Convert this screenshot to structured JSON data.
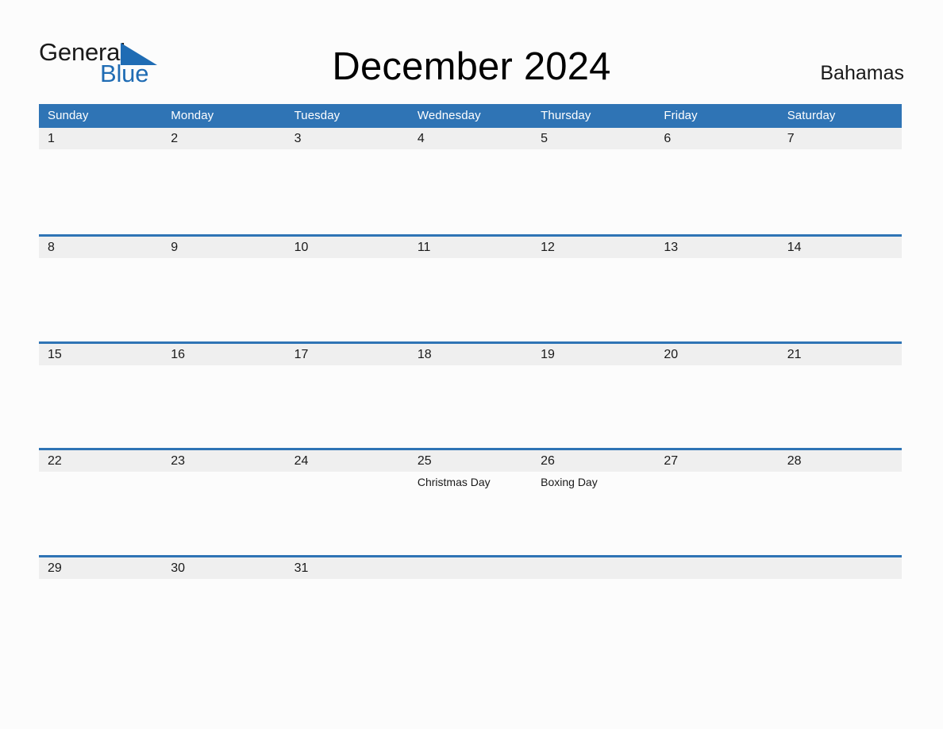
{
  "brand": {
    "name_part1": "General",
    "name_part2": "Blue",
    "accent_color": "#1f6cb4",
    "triangle_icon": "triangle-icon"
  },
  "header": {
    "title": "December 2024",
    "country": "Bahamas"
  },
  "calendar": {
    "month": "December",
    "year": "2024",
    "header_bg": "#2f74b5",
    "daynum_band_bg": "#efefef",
    "weekdays": [
      "Sunday",
      "Monday",
      "Tuesday",
      "Wednesday",
      "Thursday",
      "Friday",
      "Saturday"
    ],
    "weeks": [
      [
        {
          "day": "1",
          "event": ""
        },
        {
          "day": "2",
          "event": ""
        },
        {
          "day": "3",
          "event": ""
        },
        {
          "day": "4",
          "event": ""
        },
        {
          "day": "5",
          "event": ""
        },
        {
          "day": "6",
          "event": ""
        },
        {
          "day": "7",
          "event": ""
        }
      ],
      [
        {
          "day": "8",
          "event": ""
        },
        {
          "day": "9",
          "event": ""
        },
        {
          "day": "10",
          "event": ""
        },
        {
          "day": "11",
          "event": ""
        },
        {
          "day": "12",
          "event": ""
        },
        {
          "day": "13",
          "event": ""
        },
        {
          "day": "14",
          "event": ""
        }
      ],
      [
        {
          "day": "15",
          "event": ""
        },
        {
          "day": "16",
          "event": ""
        },
        {
          "day": "17",
          "event": ""
        },
        {
          "day": "18",
          "event": ""
        },
        {
          "day": "19",
          "event": ""
        },
        {
          "day": "20",
          "event": ""
        },
        {
          "day": "21",
          "event": ""
        }
      ],
      [
        {
          "day": "22",
          "event": ""
        },
        {
          "day": "23",
          "event": ""
        },
        {
          "day": "24",
          "event": ""
        },
        {
          "day": "25",
          "event": "Christmas Day"
        },
        {
          "day": "26",
          "event": "Boxing Day"
        },
        {
          "day": "27",
          "event": ""
        },
        {
          "day": "28",
          "event": ""
        }
      ],
      [
        {
          "day": "29",
          "event": ""
        },
        {
          "day": "30",
          "event": ""
        },
        {
          "day": "31",
          "event": ""
        },
        {
          "day": "",
          "event": ""
        },
        {
          "day": "",
          "event": ""
        },
        {
          "day": "",
          "event": ""
        },
        {
          "day": "",
          "event": ""
        }
      ]
    ]
  }
}
